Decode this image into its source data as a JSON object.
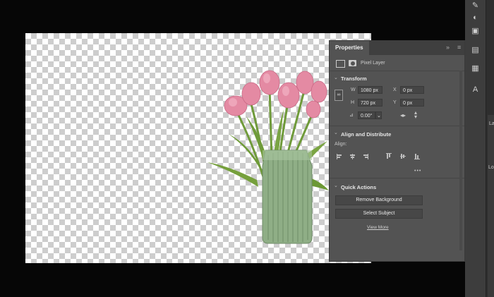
{
  "panel": {
    "title": "Properties",
    "layer_type": "Pixel Layer",
    "transform": {
      "title": "Transform",
      "w_label": "W",
      "w_value": "1080 px",
      "h_label": "H",
      "h_value": "720 px",
      "x_label": "X",
      "x_value": "0 px",
      "y_label": "Y",
      "y_value": "0 px",
      "angle_value": "0.00°"
    },
    "align": {
      "title": "Align and Distribute",
      "label": "Align:",
      "more": "•••"
    },
    "quick_actions": {
      "title": "Quick Actions",
      "remove_bg": "Remove Background",
      "select_subject": "Select Subject",
      "view_more": "View More"
    }
  },
  "right_edge": {
    "label_l1": "La",
    "label_l2": "Lo"
  },
  "colors": {
    "panel_bg": "#535353",
    "canvas_checker": "#cdcdcd",
    "tulip_pink": "#e58aa4",
    "stem_green": "#6f9a3a"
  }
}
